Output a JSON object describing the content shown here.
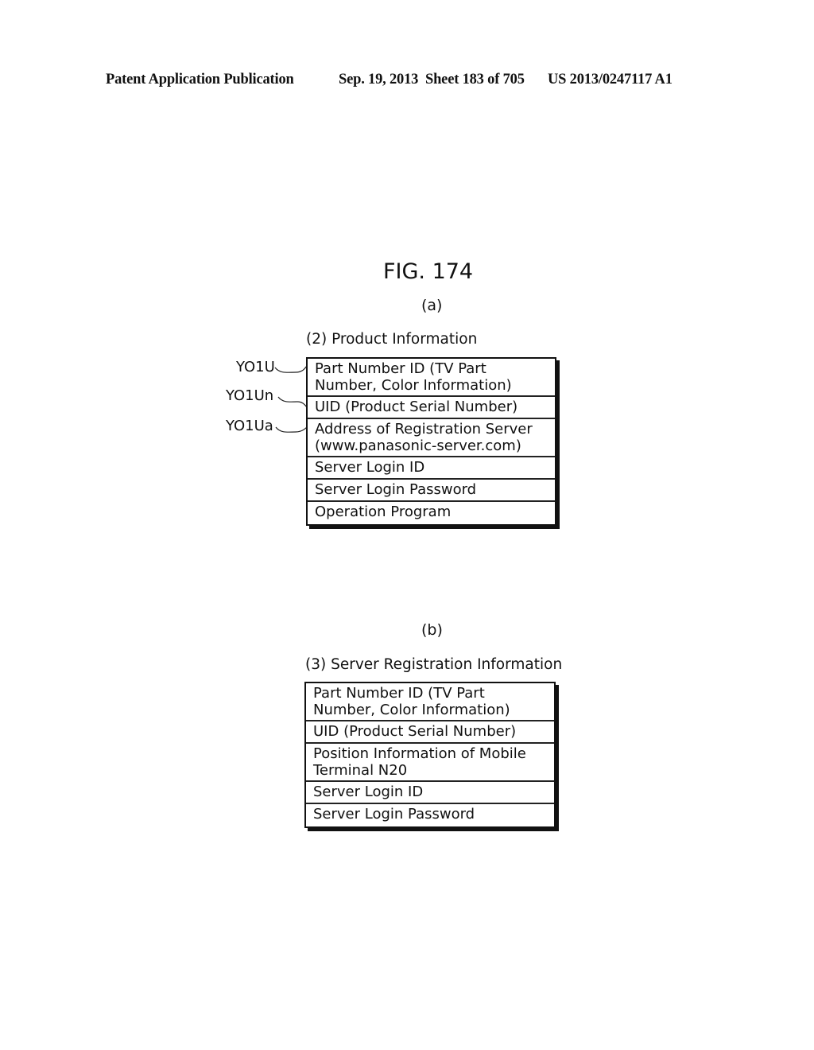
{
  "header": {
    "publication": "Patent Application Publication",
    "date": "Sep. 19, 2013",
    "sheet": "Sheet 183 of 705",
    "number": "US 2013/0247117 A1"
  },
  "figure": {
    "title": "FIG. 174",
    "part_a": {
      "label": "(a)",
      "table_title": "(2) Product Information",
      "rows": [
        "Part Number ID (TV Part\nNumber, Color Information)",
        "UID (Product Serial Number)",
        "Address of Registration Server\n(www.panasonic-server.com)",
        "Server Login ID",
        "Server Login Password",
        "Operation Program"
      ],
      "reference_labels": [
        "YO1U",
        "YO1Un",
        "YO1Ua"
      ]
    },
    "part_b": {
      "label": "(b)",
      "table_title": "(3) Server Registration Information",
      "rows": [
        "Part Number ID (TV Part\nNumber, Color Information)",
        "UID (Product Serial Number)",
        "Position Information of Mobile\nTerminal N20",
        "Server Login ID",
        "Server Login Password"
      ]
    }
  }
}
